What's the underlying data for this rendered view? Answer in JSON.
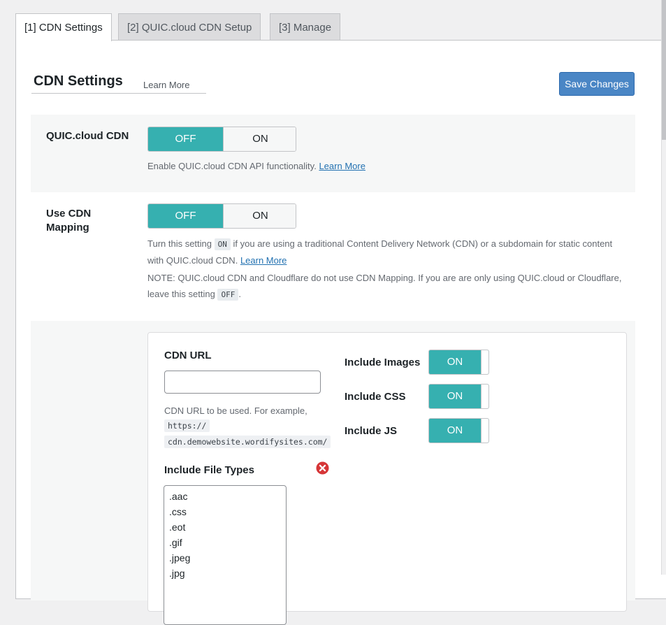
{
  "tabs": [
    {
      "label": "[1] CDN Settings"
    },
    {
      "label": "[2] QUIC.cloud CDN Setup"
    },
    {
      "label": "[3] Manage"
    }
  ],
  "header": {
    "title": "CDN Settings",
    "learn_more": "Learn More",
    "save_label": "Save Changes"
  },
  "quic_cdn": {
    "label": "QUIC.cloud CDN",
    "off": "OFF",
    "on": "ON",
    "desc": "Enable QUIC.cloud CDN API functionality.",
    "link": "Learn More",
    "selected": "OFF"
  },
  "cdn_mapping": {
    "label_line1": "Use CDN",
    "label_line2": "Mapping",
    "off": "OFF",
    "on": "ON",
    "selected": "OFF",
    "desc_a1": "Turn this setting",
    "desc_code1": "ON",
    "desc_a2": "if you are using a traditional Content Delivery Network (CDN) or a subdomain for static content",
    "desc_a3": "with QUIC.cloud CDN.",
    "desc_link": "Learn More",
    "note_1": "NOTE: QUIC.cloud CDN and Cloudflare do not use CDN Mapping. If you are are only using QUIC.cloud or Cloudflare,",
    "note_2": "leave this setting",
    "note_code": "OFF",
    "note_end": "."
  },
  "mapping_box": {
    "cdn_url_label": "CDN URL",
    "cdn_url_value": "",
    "cdn_url_desc": "CDN URL to be used. For example,",
    "example_1": "https://",
    "example_2": "cdn.demowebsite.wordifysites.com/",
    "include_images": {
      "label": "Include Images",
      "state": "ON"
    },
    "include_css": {
      "label": "Include CSS",
      "state": "ON"
    },
    "include_js": {
      "label": "Include JS",
      "state": "ON"
    },
    "file_types_label": "Include File Types",
    "file_types": [
      ".aac",
      ".css",
      ".eot",
      ".gif",
      ".jpeg",
      ".jpg"
    ]
  },
  "colors": {
    "accent": "#36b0b0",
    "primary_button": "#4a86c5",
    "link": "#2271b1",
    "remove_icon": "#d63638"
  }
}
